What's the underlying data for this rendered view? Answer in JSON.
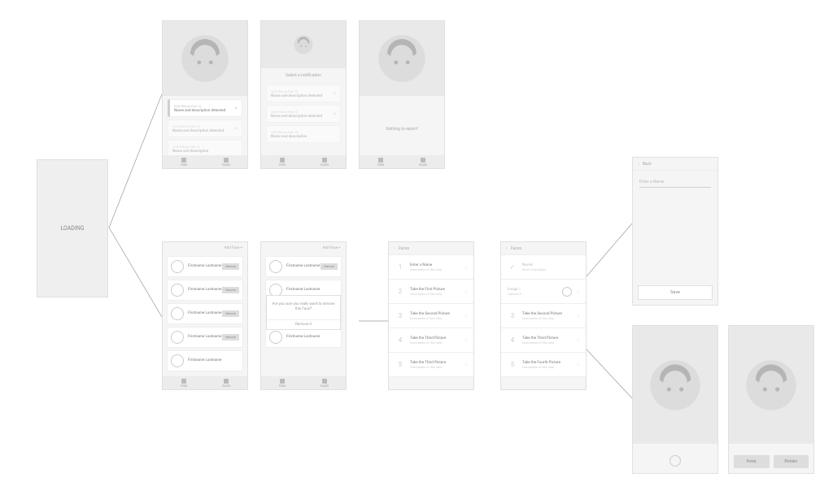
{
  "loading": {
    "label": "LOADING"
  },
  "tabs": {
    "feed": "FEED",
    "faces": "FACES"
  },
  "feed": {
    "time": "4:02 PM on Feb 13",
    "title_selected": "Name and description detected",
    "title_other": "Name and description detected",
    "title_partial": "Name and description",
    "select_caption": "Select a notification",
    "nothing": "Nothing to report!",
    "close": "×"
  },
  "faces_list": {
    "header": "Add Face  +",
    "name": "Firstname\nLastname",
    "remove": "Remove",
    "confirm_text": "Are you sure you really want to remove this Face?",
    "confirm_btn": "Remove it"
  },
  "steps_header": "Faces",
  "steps_a": [
    {
      "n": "1",
      "title": "Enter a Name",
      "desc": "Description of this step"
    },
    {
      "n": "2",
      "title": "Take the First Picture",
      "desc": "Description of this step"
    },
    {
      "n": "3",
      "title": "Take the Second Picture",
      "desc": "Description of this step"
    },
    {
      "n": "4",
      "title": "Take the Third Picture",
      "desc": "Description of this step"
    },
    {
      "n": "5",
      "title": "Take the Third Picture",
      "desc": "Description of this step"
    }
  ],
  "steps_b": {
    "done_title": "Name!",
    "done_desc": "Short Description",
    "pending_title": "Image 1",
    "pending_desc": "Capture it!",
    "rest": [
      {
        "n": "3",
        "title": "Take the Second Picture",
        "desc": "Description of this step"
      },
      {
        "n": "4",
        "title": "Take the Third Picture",
        "desc": "Description of this step"
      },
      {
        "n": "5",
        "title": "Take the Fourth Picture",
        "desc": "Description of this step"
      }
    ]
  },
  "name_entry": {
    "back": "Back",
    "placeholder": "Enter a Name",
    "save": "Save"
  },
  "camera": {
    "keep": "Keep",
    "retake": "Retake"
  }
}
